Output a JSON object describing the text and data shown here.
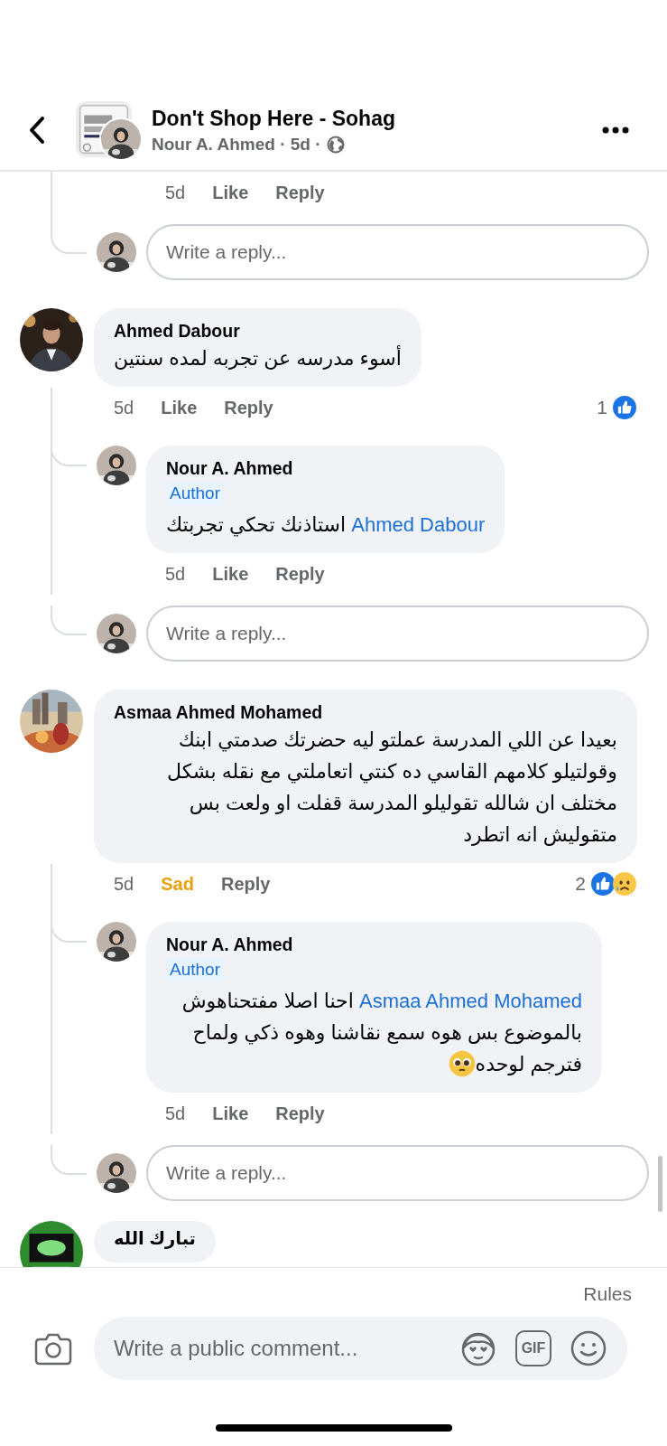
{
  "header": {
    "title": "Don't Shop Here - Sohag",
    "subtitle": "Nour A. Ahmed · 5d ·"
  },
  "top_tail": {
    "actions": {
      "time": "5d",
      "like": "Like",
      "reply": "Reply",
      "reacted": false
    },
    "reply_placeholder": "Write a reply..."
  },
  "threads": [
    {
      "author": "Ahmed Dabour",
      "text": "أسوء مدرسه عن تجربه لمده سنتين",
      "actions": {
        "time": "5d",
        "like": "Like",
        "reply": "Reply",
        "reacted": false,
        "reactions": {
          "count": "1",
          "like": true
        }
      },
      "replies": [
        {
          "author": "Nour A. Ahmed",
          "badge": "Author",
          "mention": "Ahmed Dabour",
          "text": "استاذنك تحكي تجربتك",
          "actions": {
            "time": "5d",
            "like": "Like",
            "reply": "Reply",
            "reacted": false
          }
        }
      ],
      "reply_placeholder": "Write a reply..."
    },
    {
      "author": "Asmaa Ahmed Mohamed",
      "text": "بعيدا عن اللي المدرسة عملتو ليه حضرتك صدمتي ابنك وقولتيلو كلامهم القاسي ده كنتي اتعاملتي مع نقله بشكل مختلف ان شالله تقوليلو المدرسة قفلت او ولعت بس متقوليش انه اتطرد",
      "actions": {
        "time": "5d",
        "like": "Sad",
        "reply": "Reply",
        "reacted": true,
        "reactions": {
          "count": "2",
          "like": true,
          "sad": true
        }
      },
      "replies": [
        {
          "author": "Nour A. Ahmed",
          "badge": "Author",
          "mention": "Asmaa Ahmed Mohamed",
          "text": "احنا اصلا مفتحناهوش بالموضوع بس هوه سمع نقاشنا وهوه ذكي ولماح فترجم لوحده",
          "pleading_emoji": true,
          "actions": {
            "time": "5d",
            "like": "Like",
            "reply": "Reply",
            "reacted": false
          }
        }
      ],
      "reply_placeholder": "Write a reply..."
    },
    {
      "author": "تبارك الله"
    }
  ],
  "composer": {
    "rules": "Rules",
    "placeholder": "Write a public comment...",
    "gif": "GIF"
  }
}
